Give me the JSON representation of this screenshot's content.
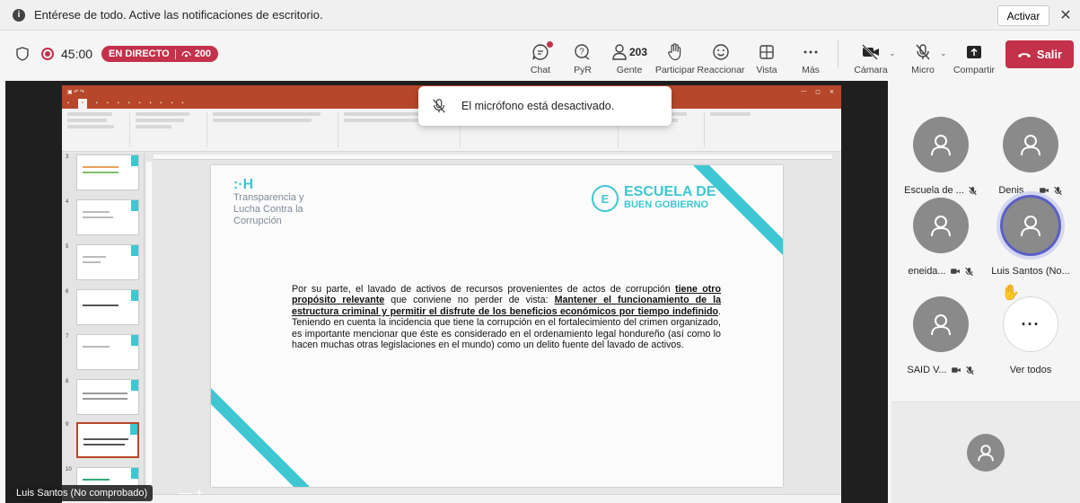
{
  "notification": {
    "text": "Entérese de todo. Active las notificaciones de escritorio.",
    "activate_label": "Activar",
    "close_glyph": "✕"
  },
  "meeting": {
    "timer": "45:00",
    "live_label": "EN DIRECTO",
    "viewer_count": "200"
  },
  "toolbar": {
    "chat": "Chat",
    "qa": "PyR",
    "people": "Gente",
    "people_count": "203",
    "raise_hand": "Participar",
    "react": "Reaccionar",
    "view": "Vista",
    "more": "Más",
    "camera": "Cámara",
    "mic": "Micro",
    "share": "Compartir",
    "leave": "Salir"
  },
  "toast": {
    "text": "El micrófono está desactivado."
  },
  "participants": [
    {
      "name": "Escuela de ..."
    },
    {
      "name": "Denis ..."
    },
    {
      "name": "eneida..."
    },
    {
      "name": "Luis Santos (No..."
    },
    {
      "name": "SAID V..."
    }
  ],
  "see_all": "Ver todos",
  "screen_share": {
    "presenter_tag": "Luis Santos (No comprobado)",
    "zoom_minus": "—",
    "zoom_plus": "+",
    "slide": {
      "logo_left_mark": ":·H",
      "logo_left_line1": "Transparencia y",
      "logo_left_line2": "Lucha Contra la",
      "logo_left_line3": "Corrupción",
      "logo_right_line1": "ESCUELA DE",
      "logo_right_line2": "BUEN GOBIERNO",
      "text_part1": "Por su parte, el lavado de activos de recursos provenientes de actos de corrupción ",
      "text_u1": "tiene otro propósito relevante",
      "text_part2": " que conviene no perder de vista: ",
      "text_u2": "Mantener el funcionamiento de la estructura criminal y permitir el disfrute de los beneficios económicos por tiempo indefinido",
      "text_part3": ". Teniendo en cuenta la incidencia que tiene la corrupción en el fortalecimiento del crimen organizado, es importante mencionar que éste es considerado en el ordenamiento legal hondureño (así como lo hacen muchas otras legislaciones en el mundo) como un delito fuente del lavado de activos."
    },
    "thumb_numbers": [
      "3",
      "4",
      "5",
      "6",
      "7",
      "8",
      "9",
      "10"
    ]
  },
  "colors": {
    "accent": "#5b5fc7",
    "danger": "#c4314b",
    "slide_teal": "#3ec7d2",
    "ppt_red": "#b7472a"
  }
}
